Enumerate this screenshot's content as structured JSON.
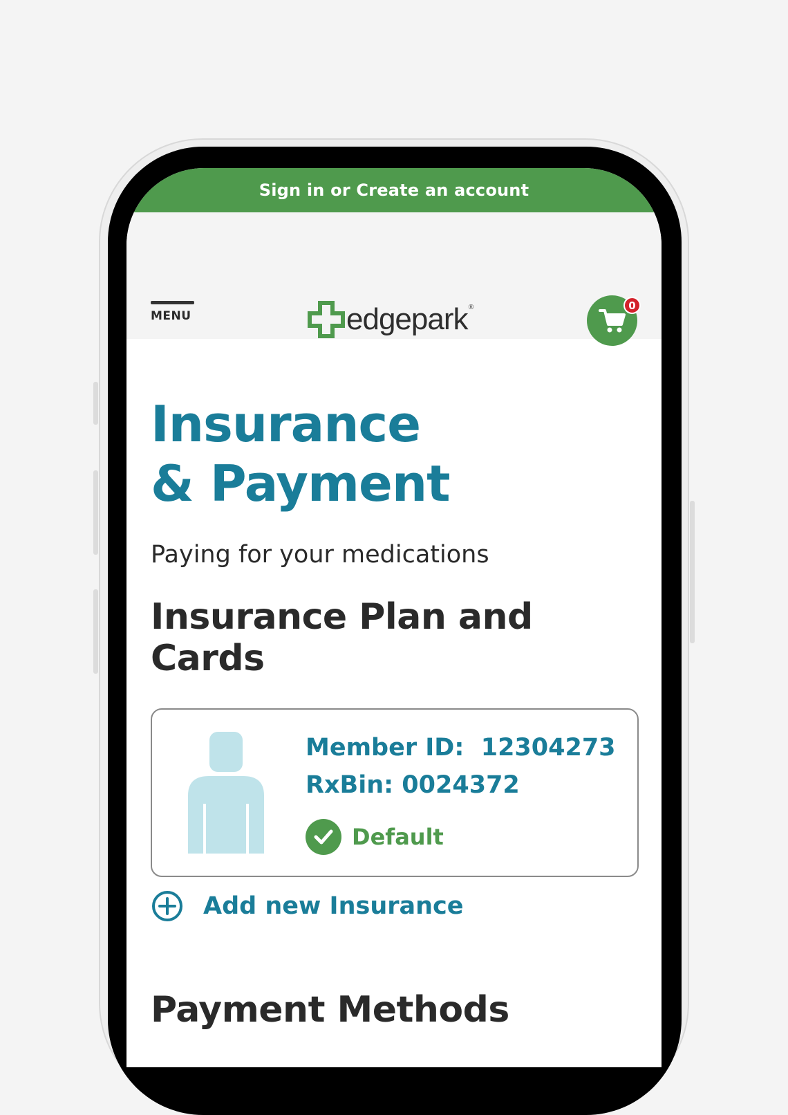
{
  "banner": {
    "label": "Sign in or Create an account"
  },
  "header": {
    "menu_label": "MENU",
    "logo_text": "edgepark",
    "logo_mark": "®",
    "cart_count": "0"
  },
  "main": {
    "title_line1": "Insurance",
    "title_line2": "& Payment",
    "subtitle": "Paying for your medications",
    "insurance_heading": "Insurance Plan and Cards",
    "card": {
      "member_id": "Member ID:  12304273",
      "rxbin": "RxBin: 0024372",
      "default_label": "Default"
    },
    "add_insurance_label": "Add new Insurance",
    "payment_heading": "Payment Methods"
  },
  "colors": {
    "brand_green": "#4f9a4d",
    "accent_teal": "#1a7d99",
    "badge_red": "#d3222a",
    "person_blue": "#bfe3ea"
  },
  "icons": [
    "hamburger-icon",
    "logo-cross-icon",
    "cart-icon",
    "person-icon",
    "checkmark-icon",
    "plus-circle-icon"
  ]
}
